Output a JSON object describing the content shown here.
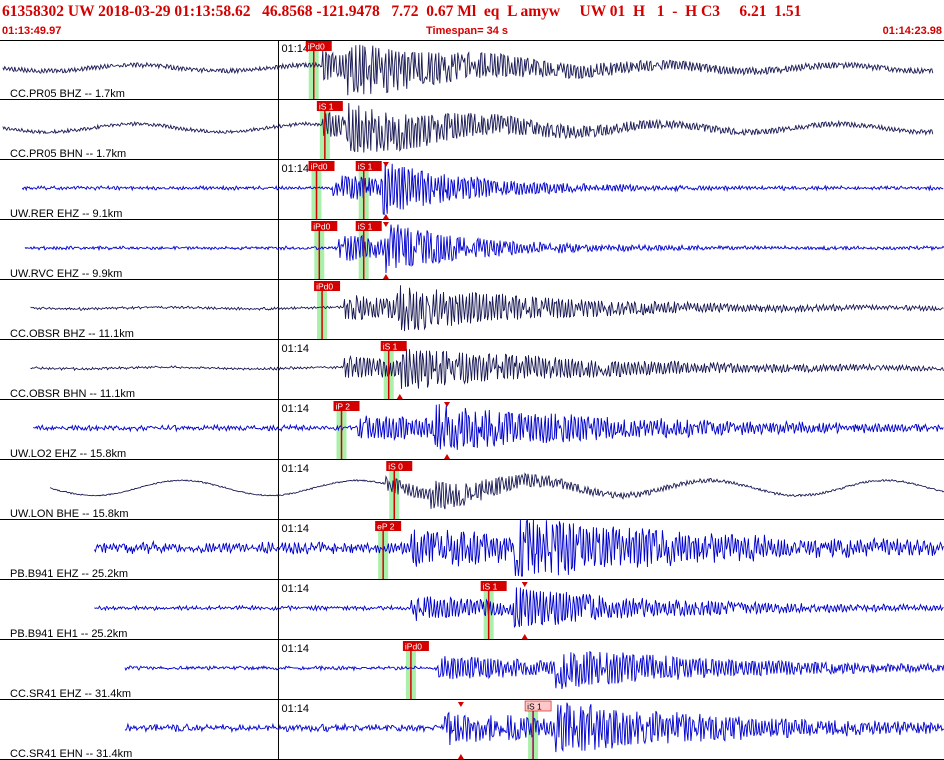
{
  "header": {
    "title": "61358302 UW 2018-03-29 01:13:58.62   46.8568 -121.9478   7.72  0.67 Ml  eq  L amyw     UW 01  H   1  -  H C3     6.21  1.51",
    "start_time": "01:13:49.97",
    "timespan_label": "Timespan=  34 s",
    "end_time": "01:14:23.98"
  },
  "chart_data": {
    "type": "line",
    "time_range_s": [
      0,
      34
    ],
    "start_time": "01:13:49.97",
    "end_time": "01:14:23.98",
    "minute_mark_label": "01:14",
    "minute_mark_time_s": 10.03,
    "colors": {
      "short_period": "#0000cc",
      "broadband": "#1a1a55",
      "pick": "#d40000",
      "window": "#aaf0aa",
      "grid": "#000000"
    },
    "traces": [
      {
        "label": "CC.PR05 BHZ -- 1.7km",
        "color": "#1a1a55",
        "start_s": 0.1,
        "end_s": 33.6,
        "p_s": 11.6,
        "s_s": 12.5,
        "amp": 0.5,
        "pre": 0.12,
        "osc": 0.11,
        "noise": 0.02,
        "decay": 5,
        "time_label": "01:14",
        "picks": [
          {
            "label": "iPd0",
            "t_s": 11.3,
            "style": "red"
          }
        ],
        "tick_marks": []
      },
      {
        "label": "CC.PR05 BHN -- 1.7km",
        "color": "#1a1a55",
        "start_s": 0.1,
        "end_s": 33.6,
        "p_s": 11.6,
        "s_s": 12.5,
        "amp": 0.45,
        "pre": 0.1,
        "osc": 0.15,
        "noise": 0.02,
        "decay": 5,
        "time_label": "",
        "picks": [
          {
            "label": "iS 1",
            "t_s": 11.7,
            "style": "red"
          }
        ],
        "tick_marks": []
      },
      {
        "label": "UW.RER EHZ -- 9.1km",
        "color": "#0000cc",
        "start_s": 0.8,
        "end_s": 34.4,
        "p_s": 12.0,
        "s_s": 13.8,
        "amp": 0.55,
        "pre": 0.06,
        "osc": 0.0,
        "noise": 0.04,
        "decay": 3,
        "time_label": "01:14",
        "picks": [
          {
            "label": "iPd0",
            "t_s": 11.4,
            "style": "red"
          },
          {
            "label": "iS 1",
            "t_s": 13.1,
            "style": "red"
          }
        ],
        "tick_marks": [
          13.9
        ]
      },
      {
        "label": "UW.RVC EHZ -- 9.9km",
        "color": "#0000cc",
        "start_s": 0.9,
        "end_s": 34.5,
        "p_s": 12.2,
        "s_s": 13.9,
        "amp": 0.55,
        "pre": 0.05,
        "osc": 0.0,
        "noise": 0.04,
        "decay": 3,
        "time_label": "",
        "picks": [
          {
            "label": "iPd0",
            "t_s": 11.5,
            "style": "red"
          },
          {
            "label": "iS 1",
            "t_s": 13.1,
            "style": "red"
          }
        ],
        "tick_marks": [
          13.9
        ]
      },
      {
        "label": "CC.OBSR BHZ -- 11.1km",
        "color": "#1a1a55",
        "start_s": 1.1,
        "end_s": 34.5,
        "p_s": 12.4,
        "s_s": 14.3,
        "amp": 0.45,
        "pre": 0.05,
        "osc": 0.03,
        "noise": 0.03,
        "decay": 6,
        "time_label": "",
        "picks": [
          {
            "label": "iPd0",
            "t_s": 11.6,
            "style": "red"
          }
        ],
        "tick_marks": []
      },
      {
        "label": "CC.OBSR BHN -- 11.1km",
        "color": "#1a1a55",
        "start_s": 1.1,
        "end_s": 34.5,
        "p_s": 12.4,
        "s_s": 14.4,
        "amp": 0.4,
        "pre": 0.05,
        "osc": 0.03,
        "noise": 0.03,
        "decay": 7,
        "time_label": "01:14",
        "picks": [
          {
            "label": "iS 1",
            "t_s": 14.0,
            "style": "red"
          }
        ],
        "tick_marks": [
          14.4
        ]
      },
      {
        "label": "UW.LO2 EHZ -- 15.8km",
        "color": "#0000cc",
        "start_s": 1.2,
        "end_s": 35.3,
        "p_s": 12.9,
        "s_s": 15.6,
        "amp": 0.45,
        "pre": 0.07,
        "osc": 0.0,
        "noise": 0.07,
        "decay": 7,
        "time_label": "01:14",
        "picks": [
          {
            "label": "iP 2",
            "t_s": 12.3,
            "style": "red"
          }
        ],
        "tick_marks": [
          16.1
        ]
      },
      {
        "label": "UW.LON BHE -- 15.8km",
        "color": "#1a1a55",
        "start_s": 1.8,
        "end_s": 35.3,
        "p_s": 13.9,
        "s_s": 15.5,
        "amp": 0.3,
        "pre": 0.03,
        "osc": 0.28,
        "noise": 0.02,
        "decay": 4,
        "time_label": "01:14",
        "picks": [
          {
            "label": "iS 0",
            "t_s": 14.2,
            "style": "red"
          }
        ],
        "tick_marks": []
      },
      {
        "label": "PB.B941 EHZ -- 25.2km",
        "color": "#0000cc",
        "start_s": 3.4,
        "end_s": 37.2,
        "p_s": 14.8,
        "s_s": 18.5,
        "amp": 0.65,
        "pre": 0.14,
        "osc": 0.0,
        "noise": 0.13,
        "decay": 6,
        "time_label": "01:14",
        "picks": [
          {
            "label": "eP 2",
            "t_s": 13.8,
            "style": "red"
          }
        ],
        "tick_marks": []
      },
      {
        "label": "PB.B941 EH1 -- 25.2km",
        "color": "#0000cc",
        "start_s": 3.4,
        "end_s": 37.2,
        "p_s": 14.8,
        "s_s": 18.5,
        "amp": 0.45,
        "pre": 0.07,
        "osc": 0.0,
        "noise": 0.05,
        "decay": 5,
        "time_label": "01:14",
        "picks": [
          {
            "label": "iS 1",
            "t_s": 17.6,
            "style": "red"
          }
        ],
        "tick_marks": [
          18.9
        ]
      },
      {
        "label": "CC.SR41 EHZ -- 31.4km",
        "color": "#0000cc",
        "start_s": 4.5,
        "end_s": 38.5,
        "p_s": 15.8,
        "s_s": 20.0,
        "amp": 0.45,
        "pre": 0.05,
        "osc": 0.0,
        "noise": 0.05,
        "decay": 6,
        "time_label": "01:14",
        "picks": [
          {
            "label": "iPd0",
            "t_s": 14.8,
            "style": "red"
          }
        ],
        "tick_marks": []
      },
      {
        "label": "CC.SR41 EHN -- 31.4km",
        "color": "#0000cc",
        "start_s": 4.5,
        "end_s": 38.5,
        "p_s": 16.0,
        "s_s": 20.0,
        "amp": 0.55,
        "pre": 0.09,
        "osc": 0.0,
        "noise": 0.09,
        "decay": 6,
        "time_label": "01:14",
        "picks": [
          {
            "label": "iS 1",
            "t_s": 19.2,
            "style": "pale"
          }
        ],
        "tick_marks": [
          16.6
        ]
      }
    ]
  }
}
